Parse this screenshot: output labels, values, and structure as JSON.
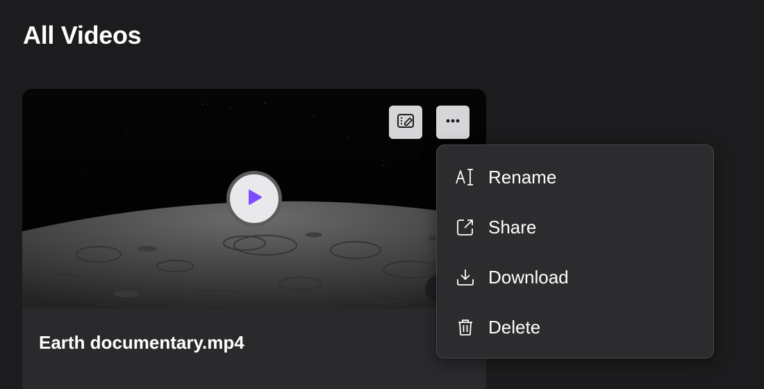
{
  "page": {
    "title": "All Videos"
  },
  "video": {
    "title": "Earth documentary.mp4",
    "actions": {
      "edit_icon": "video-edit-icon",
      "more_icon": "more-horizontal-icon"
    },
    "play_icon": "play-icon",
    "play_color": "#7c4dff"
  },
  "context_menu": {
    "items": [
      {
        "label": "Rename",
        "icon": "rename-text-cursor-icon"
      },
      {
        "label": "Share",
        "icon": "share-external-icon"
      },
      {
        "label": "Download",
        "icon": "download-icon"
      },
      {
        "label": "Delete",
        "icon": "trash-icon"
      }
    ]
  },
  "colors": {
    "background": "#1c1c1e",
    "card": "#2a2a2d",
    "menu": "#2c2c2f",
    "accent": "#7c4dff"
  }
}
